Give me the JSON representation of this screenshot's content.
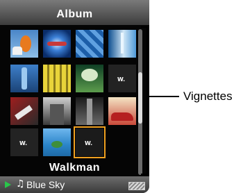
{
  "header": {
    "title": "Album"
  },
  "grid": {
    "selected_label": "Walkman"
  },
  "status_bar": {
    "now_playing": "Blue Sky",
    "play_icon": "play-icon",
    "note_icon": "music-note-icon",
    "battery_icon": "battery-icon"
  },
  "callout": {
    "label": "Vignettes"
  },
  "thumbnails": [
    {
      "name": "album-thumb-halloween",
      "selected": false
    },
    {
      "name": "album-thumb-blue-orb",
      "selected": false
    },
    {
      "name": "album-thumb-blue-tiles",
      "selected": false
    },
    {
      "name": "album-thumb-blue-glass",
      "selected": false
    },
    {
      "name": "album-thumb-blue-bottle",
      "selected": false
    },
    {
      "name": "album-thumb-yellow-tubes",
      "selected": false
    },
    {
      "name": "album-thumb-green-tree",
      "selected": false
    },
    {
      "name": "album-thumb-walkman-logo",
      "selected": false
    },
    {
      "name": "album-thumb-red-guitar",
      "selected": false
    },
    {
      "name": "album-thumb-building",
      "selected": false
    },
    {
      "name": "album-thumb-poster",
      "selected": false
    },
    {
      "name": "album-thumb-red-car",
      "selected": false
    },
    {
      "name": "album-thumb-walkman-logo",
      "selected": false
    },
    {
      "name": "album-thumb-island",
      "selected": false
    },
    {
      "name": "album-thumb-walkman-selected",
      "selected": true
    }
  ],
  "scrollbar": {
    "position": 0.35
  },
  "colors": {
    "accent_selection": "#f0a020",
    "play_green": "#29c64a"
  }
}
